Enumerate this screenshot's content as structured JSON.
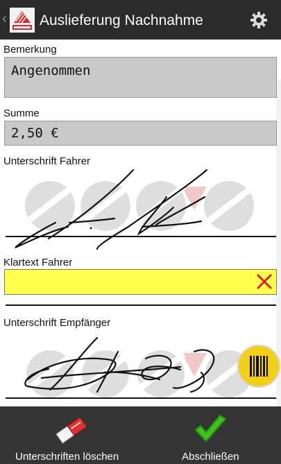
{
  "appbar": {
    "back_icon": "chevron-left-icon",
    "logo": "cosys-logo",
    "title": "Auslieferung Nachnahme",
    "settings_icon": "gear-icon"
  },
  "form": {
    "bemerkung": {
      "label": "Bemerkung",
      "value": "Angenommen"
    },
    "summe": {
      "label": "Summe",
      "value": "2,50 €"
    },
    "unterschrift_fahrer": {
      "label": "Unterschrift Fahrer"
    },
    "klartext_fahrer": {
      "label": "Klartext Fahrer",
      "value": "",
      "clear_icon": "clear-x-icon"
    },
    "unterschrift_empfaenger": {
      "label": "Unterschrift Empfänger"
    },
    "scan_button_icon": "barcode-icon"
  },
  "bottom_bar": {
    "clear_signatures": {
      "label": "Unterschriften löschen",
      "icon": "eraser-icon"
    },
    "finish": {
      "label": "Abschließen",
      "icon": "checkmark-icon"
    }
  },
  "colors": {
    "appbar": "#2b2b2b",
    "field": "#c9c9c9",
    "highlight_field": "#ffff4d",
    "scan_button": "#f3d017",
    "clear_icon": "#e02020",
    "check": "#3cc21a"
  }
}
